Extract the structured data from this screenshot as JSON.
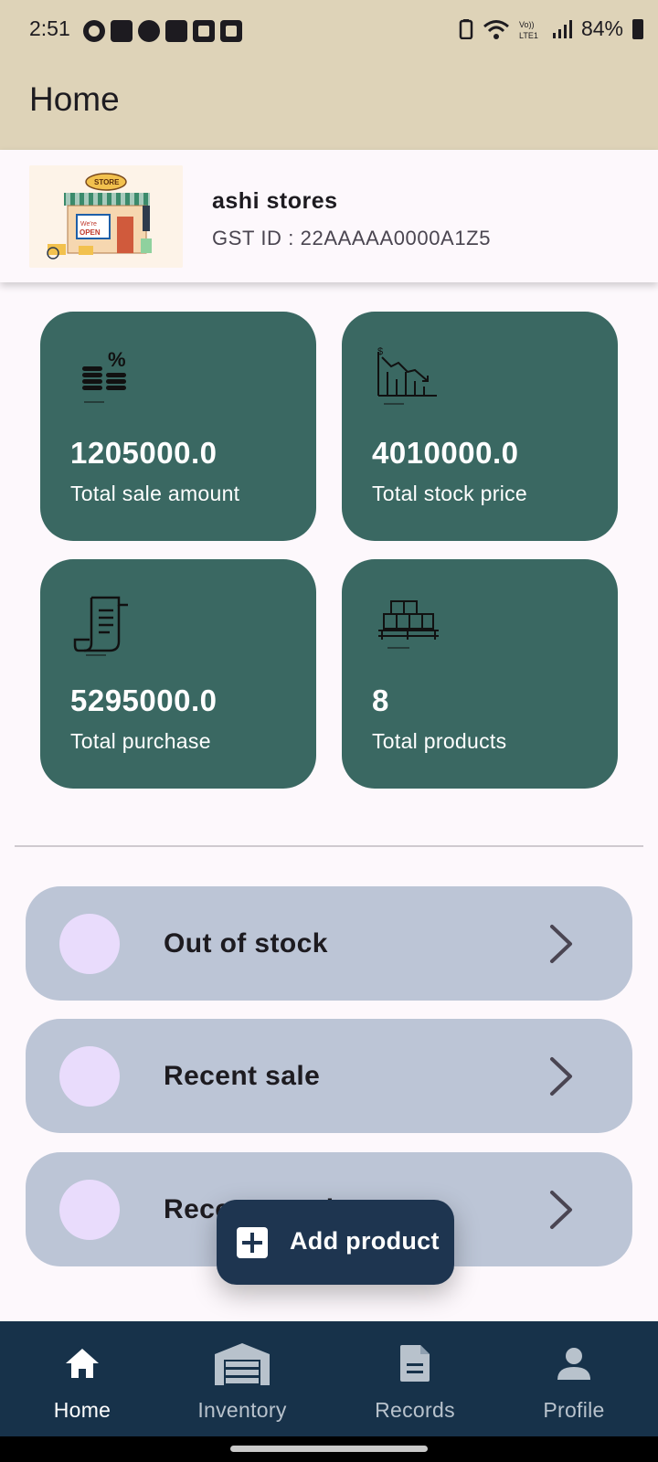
{
  "status_bar": {
    "time": "2:51",
    "battery": "84%",
    "left_icons": [
      "whatsapp-icon",
      "linkedin-icon",
      "play-icon",
      "youtube-icon",
      "check-icon",
      "gallery-icon"
    ],
    "right_icons": [
      "battery-saver-icon",
      "wifi-icon",
      "volte-icon",
      "signal-icon",
      "battery-icon"
    ]
  },
  "app_bar": {
    "title": "Home"
  },
  "store": {
    "name": "ashi stores",
    "gst": "GST ID : 22AAAAA0000A1Z5",
    "image_icon": "store-illustration"
  },
  "stats": [
    {
      "value": "1205000.0",
      "label": "Total sale amount",
      "icon": "coins-percent-icon"
    },
    {
      "value": "4010000.0",
      "label": "Total stock price",
      "icon": "chart-down-icon"
    },
    {
      "value": "5295000.0",
      "label": "Total purchase",
      "icon": "receipt-icon"
    },
    {
      "value": "8",
      "label": "Total products",
      "icon": "boxes-pallet-icon"
    }
  ],
  "rows": [
    {
      "label": "Out of stock"
    },
    {
      "label": "Recent sale"
    },
    {
      "label": "Recent purchase"
    }
  ],
  "fab": {
    "label": "Add product"
  },
  "bottom_nav": [
    {
      "label": "Home",
      "icon": "home-icon",
      "active": true
    },
    {
      "label": "Inventory",
      "icon": "warehouse-icon",
      "active": false
    },
    {
      "label": "Records",
      "icon": "document-icon",
      "active": false
    },
    {
      "label": "Profile",
      "icon": "person-icon",
      "active": false
    }
  ],
  "colors": {
    "header": "#ded3b8",
    "stat_card": "#3a6862",
    "row": "#bcc5d6",
    "fab": "#1e3550",
    "bottom_nav": "#17324a"
  }
}
